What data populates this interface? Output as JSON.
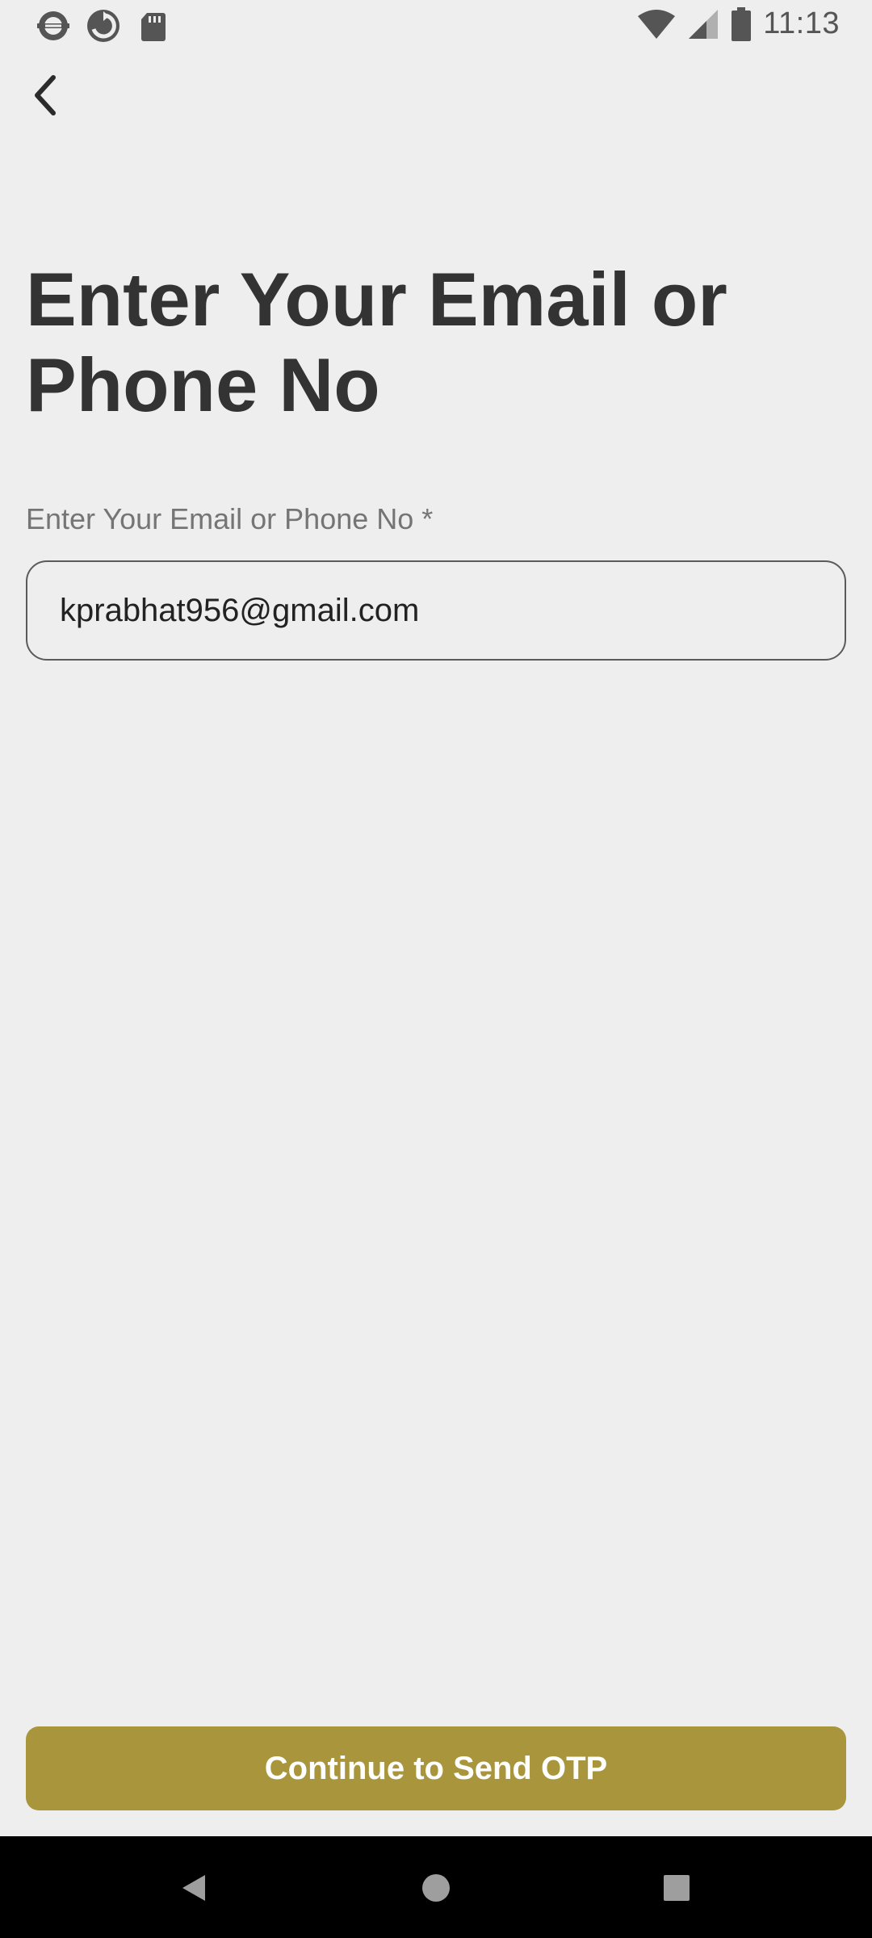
{
  "status_bar": {
    "time": "11:13",
    "left_icons": [
      "metro-icon",
      "sync-icon",
      "sd-card-icon"
    ],
    "right_icons": [
      "wifi-icon",
      "signal-icon",
      "battery-icon"
    ]
  },
  "header": {
    "back_icon": "chevron-left-icon"
  },
  "main": {
    "title": "Enter Your Email or Phone No",
    "field_label": "Enter Your Email or Phone No *",
    "email_value": "kprabhat956@gmail.com"
  },
  "cta": {
    "label": "Continue to Send OTP",
    "color": "#a8953c"
  },
  "nav": {
    "icons": [
      "nav-back-icon",
      "nav-home-icon",
      "nav-recents-icon"
    ]
  }
}
